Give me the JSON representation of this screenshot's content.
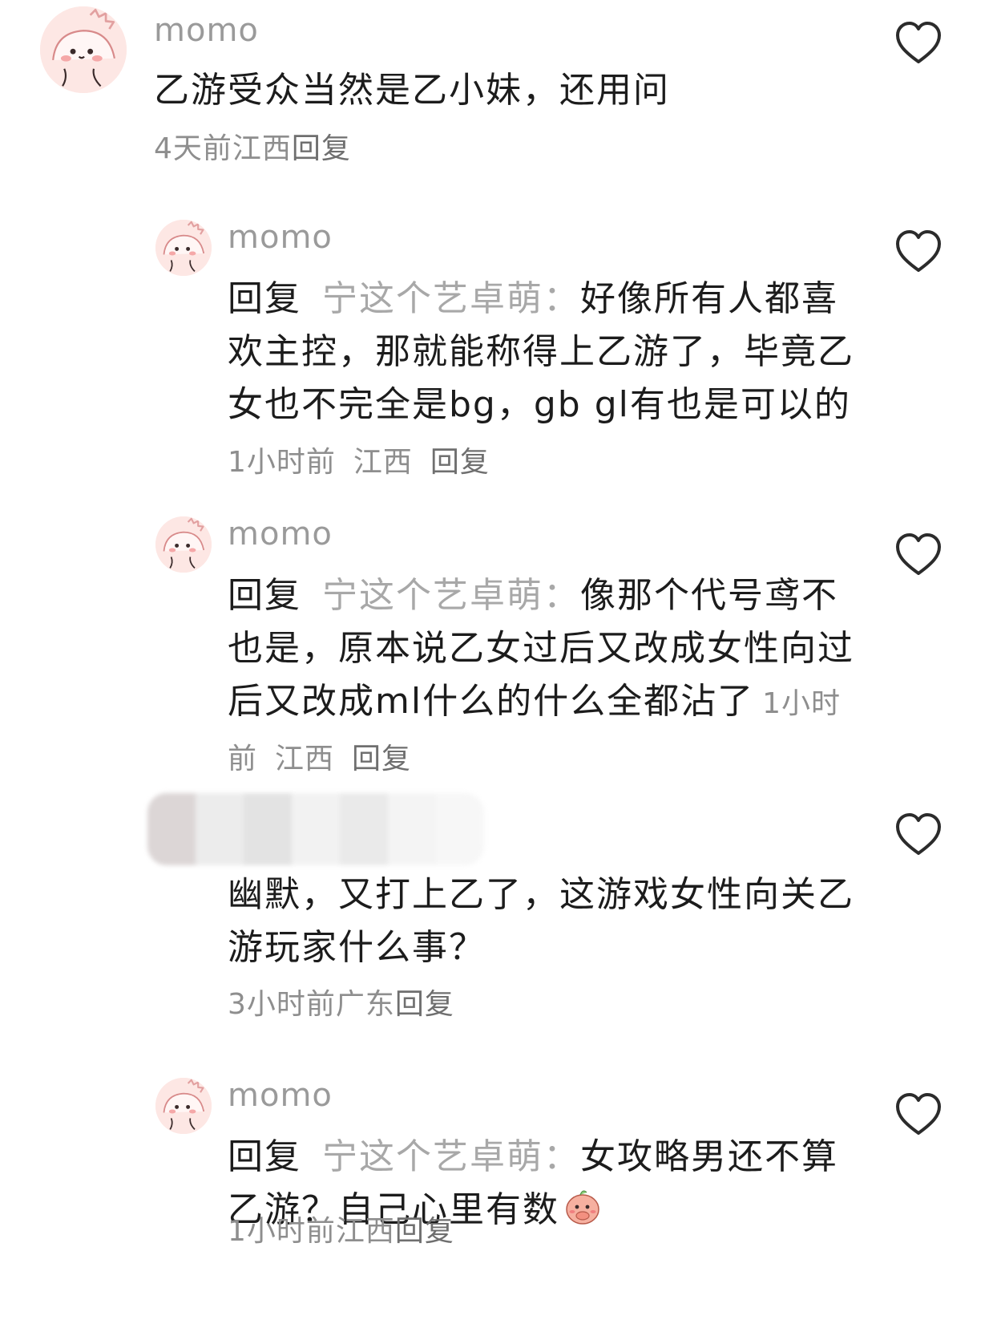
{
  "comments": [
    {
      "username": "momo",
      "text": "乙游受众当然是乙小妹，还用问",
      "time": "4天前",
      "location": "江西",
      "reply_label": "回复"
    },
    {
      "username": "momo",
      "reply_prefix": "回复",
      "reply_target": "宁这个艺卓萌：",
      "text": "好像所有人都喜欢主控，那就能称得上乙游了，毕竟乙女也不完全是bg，gb gl有也是可以的",
      "time": "1小时前",
      "location": "江西",
      "reply_label": "回复"
    },
    {
      "username": "momo",
      "reply_prefix": "回复",
      "reply_target": "宁这个艺卓萌：",
      "text": "像那个代号鸢不也是，原本说乙女过后又改成女性向过后又改成ml什么的什么全都沾了",
      "time": "1小时前",
      "location": "江西",
      "reply_label": "回复"
    },
    {
      "text": "幽默，又打上乙了，这游戏女性向关乙游玩家什么事？",
      "time": "3小时前",
      "location": "广东",
      "reply_label": "回复"
    },
    {
      "username": "momo",
      "reply_prefix": "回复",
      "reply_target": "宁这个艺卓萌：",
      "text": "女攻略男还不算乙游？自己心里有数",
      "time": "1小时前",
      "location": "江西",
      "reply_label": "回复"
    }
  ],
  "icons": {
    "like": "heart-outline-icon",
    "avatar": "cartoon-avatar-icon",
    "emoji": "covering-mouth-emoji-icon"
  },
  "colors": {
    "text": "#1c1c1c",
    "username": "#9a9a9a",
    "meta": "#8e8e8e",
    "reply_target": "#a8a8a8",
    "avatar_bg": "#fde7e4"
  }
}
